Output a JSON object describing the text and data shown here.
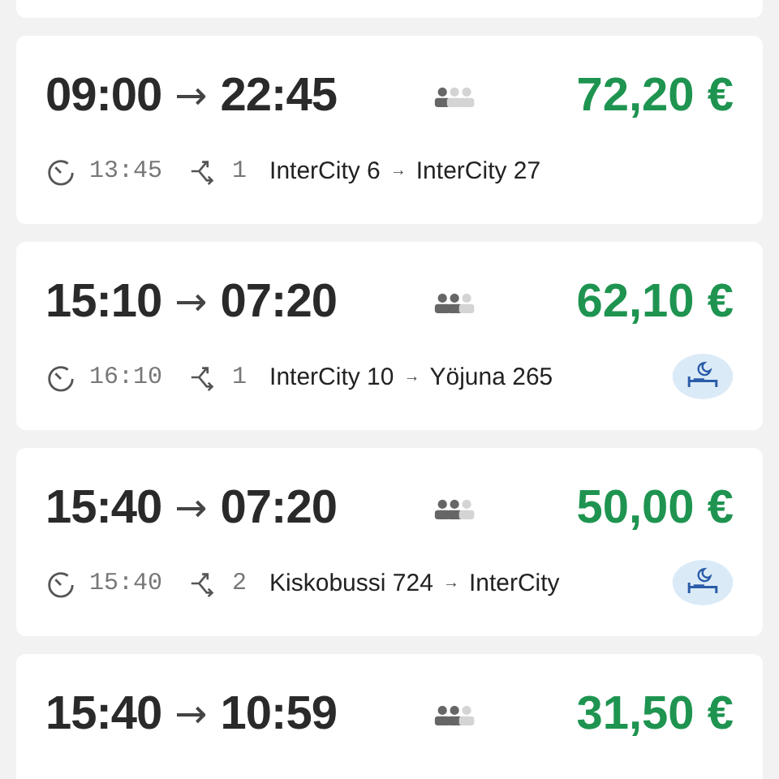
{
  "connections": [
    {
      "departure": "09:00",
      "arrow": "→",
      "arrival": "22:45",
      "persons": [
        {
          "filled": true
        },
        {
          "filled": false
        },
        {
          "filled": false
        }
      ],
      "price": "72,20 €",
      "duration": "13:45",
      "transfers": "1",
      "trains": [
        "InterCity 6",
        "InterCity 27"
      ],
      "sleeper": false
    },
    {
      "departure": "15:10",
      "arrow": "→",
      "arrival": "07:20",
      "persons": [
        {
          "filled": true
        },
        {
          "filled": true
        },
        {
          "filled": false
        }
      ],
      "price": "62,10 €",
      "duration": "16:10",
      "transfers": "1",
      "trains": [
        "InterCity 10",
        "Yöjuna 265"
      ],
      "sleeper": true
    },
    {
      "departure": "15:40",
      "arrow": "→",
      "arrival": "07:20",
      "persons": [
        {
          "filled": true
        },
        {
          "filled": true
        },
        {
          "filled": false
        }
      ],
      "price": "50,00 €",
      "duration": "15:40",
      "transfers": "2",
      "trains": [
        "Kiskobussi 724",
        "InterCity"
      ],
      "sleeper": true
    },
    {
      "departure": "15:40",
      "arrow": "→",
      "arrival": "10:59",
      "persons": [
        {
          "filled": true
        },
        {
          "filled": true
        },
        {
          "filled": false
        }
      ],
      "price": "31,50 €"
    }
  ],
  "train_separator": "→"
}
